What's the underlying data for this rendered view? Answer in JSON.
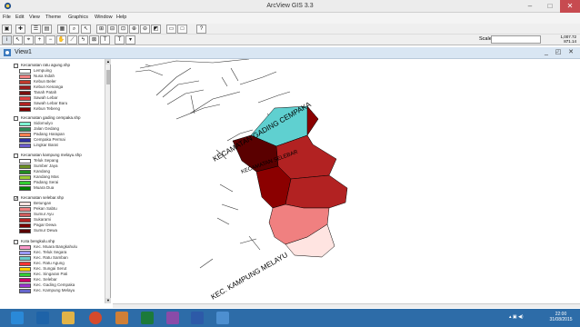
{
  "window": {
    "title": "ArcView GIS 3.3"
  },
  "menu": [
    "File",
    "Edit",
    "View",
    "Theme",
    "Graphics",
    "Window",
    "Help"
  ],
  "toolbar": {
    "scale_label": "Scale 1:",
    "scale_value": "",
    "coord_x": "1,007.72",
    "coord_y": "871.14"
  },
  "view": {
    "title": "View1"
  },
  "themes": [
    {
      "name": "Kecamatan ratu agung.shp",
      "checked": false,
      "classes": [
        {
          "label": "Lempuing",
          "color": "#ffffff"
        },
        {
          "label": "Nusa Indah",
          "color": "#f08080"
        },
        {
          "label": "Kebun Beler",
          "color": "#c0392b"
        },
        {
          "label": "Kebun Kenanga",
          "color": "#9b1b1b"
        },
        {
          "label": "Tanah Patah",
          "color": "#7a1010"
        },
        {
          "label": "Sawah Lebar",
          "color": "#e04040"
        },
        {
          "label": "Sawah Lebar Baru",
          "color": "#b22222"
        },
        {
          "label": "Kebun Tebeng",
          "color": "#800000"
        }
      ]
    },
    {
      "name": "Kecamatan gading cempaka.shp",
      "checked": false,
      "classes": [
        {
          "label": "Sidomulyo",
          "color": "#7fffd4"
        },
        {
          "label": "Jalan Gedang",
          "color": "#2e8b57"
        },
        {
          "label": "Padang Harapan",
          "color": "#ff7f50"
        },
        {
          "label": "Cempaka Permai",
          "color": "#3030a0"
        },
        {
          "label": "Lingkar Barat",
          "color": "#6a5acd"
        }
      ]
    },
    {
      "name": "Kecamatan kampung melayu.shp",
      "checked": false,
      "classes": [
        {
          "label": "Teluk Sepang",
          "color": "#ffffff"
        },
        {
          "label": "Sumber Jaya",
          "color": "#6b8e23"
        },
        {
          "label": "Kandang",
          "color": "#228b22"
        },
        {
          "label": "Kandang Mas",
          "color": "#9acd32"
        },
        {
          "label": "Padang Serai",
          "color": "#32cd32"
        },
        {
          "label": "Muara Dua",
          "color": "#008000"
        }
      ]
    },
    {
      "name": "Kecamatan selebar.shp",
      "checked": true,
      "classes": [
        {
          "label": "Betungan",
          "color": "#ffe4e1"
        },
        {
          "label": "Pekan Sabtu",
          "color": "#f08080"
        },
        {
          "label": "Sumur Ayu",
          "color": "#cd5c5c"
        },
        {
          "label": "Sukarami",
          "color": "#b22222"
        },
        {
          "label": "Pagar Dewa",
          "color": "#7a0000"
        },
        {
          "label": "Sumur Dewa",
          "color": "#5a0000"
        }
      ]
    },
    {
      "name": "Kota bengkulu.shp",
      "checked": false,
      "classes": [
        {
          "label": "Kec. Muara Bangkahulu",
          "color": "#ff99cc"
        },
        {
          "label": "Kec. Teluk Segara",
          "color": "#9999ff"
        },
        {
          "label": "Kec. Ratu Samban",
          "color": "#66cccc"
        },
        {
          "label": "Kec. Ratu Agung",
          "color": "#ff3333"
        },
        {
          "label": "Kec. Sungai Serut",
          "color": "#ffcc00"
        },
        {
          "label": "Kec. Singaran Pati",
          "color": "#33cc33"
        },
        {
          "label": "Kec. Selebar",
          "color": "#cc0066"
        },
        {
          "label": "Kec. Gading Cempaka",
          "color": "#9933cc"
        },
        {
          "label": "Kec. Kampung Melayu",
          "color": "#6666cc"
        }
      ]
    }
  ],
  "map": {
    "labels": {
      "gading_cempaka": "KECAMATAN GADING CEMPAKA",
      "selebar": "KECAMATAN SELEBAR",
      "kampung_melayu": "KEC. KAMPUNG MELAYU"
    },
    "colors": {
      "teal": "#5fd0d0",
      "dark": "#5a0000",
      "maroon": "#8b0000",
      "red": "#b22222",
      "salmon": "#f08080",
      "pink": "#ffe4e1"
    }
  },
  "taskbar": {
    "time": "22:00",
    "date": "31/08/2015"
  }
}
